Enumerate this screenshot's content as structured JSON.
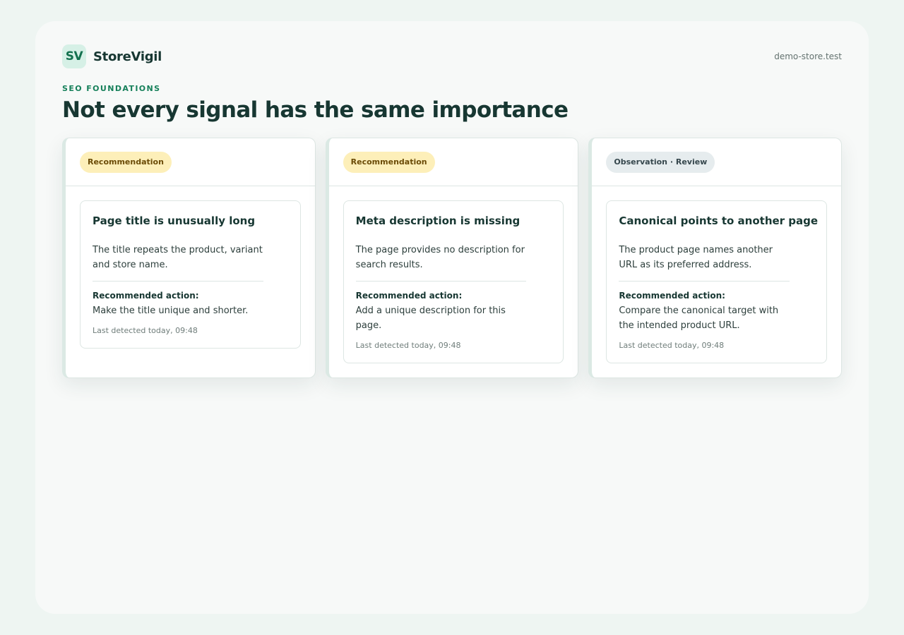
{
  "brand": {
    "logo_text": "SV",
    "name": "StoreVigil"
  },
  "store": {
    "domain": "demo-store.test"
  },
  "section": {
    "eyebrow": "SEO FOUNDATIONS",
    "title": "Not every signal has the same importance"
  },
  "colors": {
    "accent": "#16805a",
    "recommendation_badge_bg": "#fdefb9",
    "recommendation_badge_text": "#6b4b06",
    "observation_badge_bg": "#e6ecee",
    "observation_badge_text": "#36474d"
  },
  "cards": [
    {
      "badge": "Recommendation",
      "title": "Page title is unusually long",
      "description": "The title repeats the product, variant and store name.",
      "action_label": "Recommended action:",
      "action": "Make the title unique and shorter.",
      "detected": "Last detected today, 09:48"
    },
    {
      "badge": "Recommendation",
      "title": "Meta description is missing",
      "description": "The page provides no description for search results.",
      "action_label": "Recommended action:",
      "action": "Add a unique description for this page.",
      "detected": "Last detected today, 09:48"
    },
    {
      "badge": "Observation · Review",
      "title": "Canonical points to another page",
      "description": "The product page names another URL as its preferred address.",
      "action_label": "Recommended action:",
      "action": "Compare the canonical target with the intended product URL.",
      "detected": "Last detected today, 09:48"
    }
  ]
}
